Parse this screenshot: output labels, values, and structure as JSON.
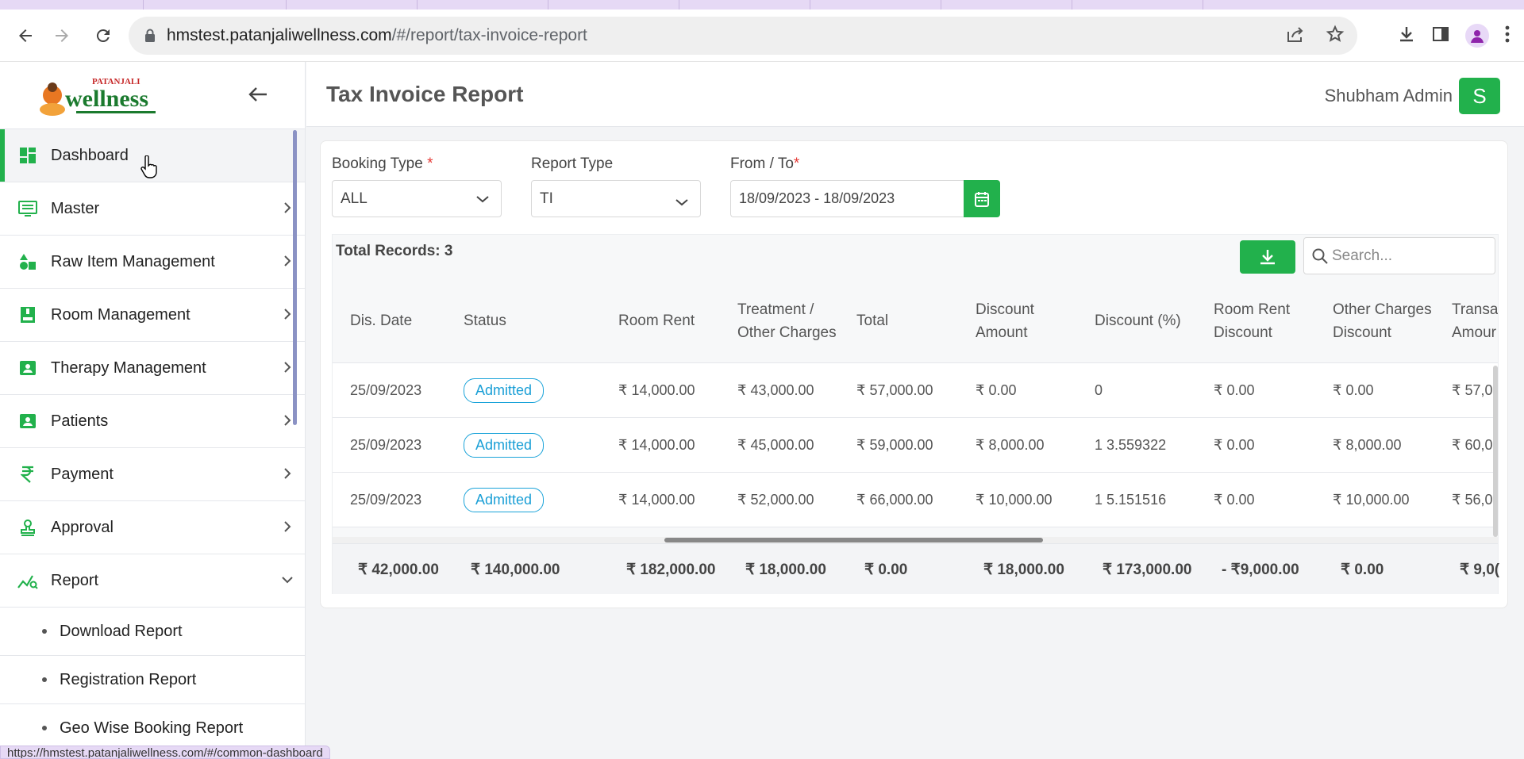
{
  "browser": {
    "url_host": "hmstest.patanjaliwellness.com",
    "url_path": "/#/report/tax-invoice-report",
    "status_url": "https://hmstest.patanjaliwellness.com/#/common-dashboard"
  },
  "sidebar": {
    "logo_alt": "PATANJALI wellness",
    "items": [
      {
        "label": "Dashboard",
        "icon": "dashboard-icon",
        "active": true
      },
      {
        "label": "Master",
        "icon": "list-icon"
      },
      {
        "label": "Raw Item Management",
        "icon": "shapes-icon"
      },
      {
        "label": "Room Management",
        "icon": "room-icon"
      },
      {
        "label": "Therapy Management",
        "icon": "therapy-icon"
      },
      {
        "label": "Patients",
        "icon": "patient-icon"
      },
      {
        "label": "Payment",
        "icon": "rupee-icon"
      },
      {
        "label": "Approval",
        "icon": "approval-icon"
      },
      {
        "label": "Report",
        "icon": "report-icon",
        "expanded": true
      }
    ],
    "sub_items": [
      {
        "label": "Download Report"
      },
      {
        "label": "Registration Report"
      },
      {
        "label": "Geo Wise Booking Report"
      }
    ]
  },
  "header": {
    "title": "Tax Invoice Report",
    "user_name": "Shubham Admin",
    "avatar_letter": "S"
  },
  "filters": {
    "booking_type_label": "Booking Type",
    "booking_type_value": "ALL",
    "report_type_label": "Report Type",
    "report_type_value": "TI",
    "date_label": "From / To",
    "date_value": "18/09/2023 - 18/09/2023",
    "required_mark": "*"
  },
  "table": {
    "total_records": "Total Records: 3",
    "search_placeholder": "Search...",
    "columns": [
      {
        "label": "Dis. Date"
      },
      {
        "label": "Status"
      },
      {
        "label": "Room Rent"
      },
      {
        "label_1": "Treatment /",
        "label_2": "Other Charges"
      },
      {
        "label": "Total"
      },
      {
        "label_1": "Discount",
        "label_2": "Amount"
      },
      {
        "label": "Discount (%)"
      },
      {
        "label_1": "Room Rent",
        "label_2": "Discount"
      },
      {
        "label_1": "Other Charges",
        "label_2": "Discount"
      },
      {
        "label_1": "Transa",
        "label_2": "Amour"
      }
    ],
    "rows": [
      {
        "dis_date": "25/09/2023",
        "status": "Admitted",
        "room_rent": "₹ 14,000.00",
        "treatment": "₹ 43,000.00",
        "total": "₹ 57,000.00",
        "discount_amount": "₹ 0.00",
        "discount_pct": "0",
        "room_rent_discount": "₹ 0.00",
        "other_charges_discount": "₹ 0.00",
        "transaction": "₹ 57,0"
      },
      {
        "dis_date": "25/09/2023",
        "status": "Admitted",
        "room_rent": "₹ 14,000.00",
        "treatment": "₹ 45,000.00",
        "total": "₹ 59,000.00",
        "discount_amount": "₹ 8,000.00",
        "discount_pct": "1 3.559322",
        "room_rent_discount": "₹ 0.00",
        "other_charges_discount": "₹ 8,000.00",
        "transaction": "₹ 60,0"
      },
      {
        "dis_date": "25/09/2023",
        "status": "Admitted",
        "room_rent": "₹ 14,000.00",
        "treatment": "₹ 52,000.00",
        "total": "₹ 66,000.00",
        "discount_amount": "₹ 10,000.00",
        "discount_pct": "1 5.151516",
        "room_rent_discount": "₹ 0.00",
        "other_charges_discount": "₹ 10,000.00",
        "transaction": "₹ 56,0"
      }
    ],
    "footer": [
      "₹ 42,000.00",
      "₹ 140,000.00",
      "₹ 182,000.00",
      "₹ 18,000.00",
      "₹ 0.00",
      "₹ 18,000.00",
      "₹ 173,000.00",
      "- ₹9,000.00",
      "₹ 0.00",
      "₹ 9,0("
    ]
  },
  "colors": {
    "accent": "#22b14c",
    "badge": "#1a9fd6"
  }
}
